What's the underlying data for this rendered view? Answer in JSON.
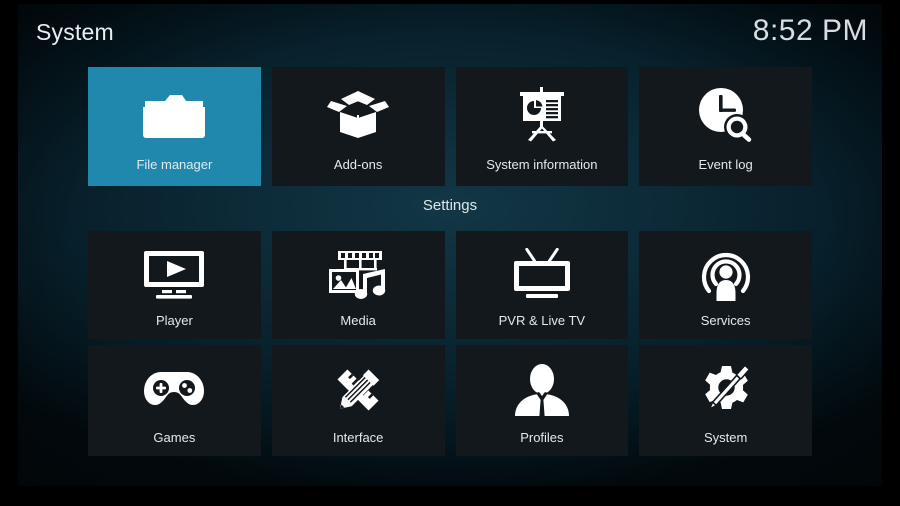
{
  "header": {
    "title": "System",
    "clock": "8:52 PM"
  },
  "settings_section": {
    "label": "Settings"
  },
  "colors": {
    "selected_tile": "#2188ad",
    "tile_background": "#13181d",
    "text": "#e3e9ec",
    "background_teal": "#0c2936"
  },
  "rows": {
    "top": [
      {
        "label": "File manager",
        "icon": "folder-open-icon",
        "selected": true
      },
      {
        "label": "Add-ons",
        "icon": "open-box-icon",
        "selected": false
      },
      {
        "label": "System information",
        "icon": "presentation-board-icon",
        "selected": false
      },
      {
        "label": "Event log",
        "icon": "clock-search-icon",
        "selected": false
      }
    ],
    "middle": [
      {
        "label": "Player",
        "icon": "monitor-play-icon",
        "selected": false
      },
      {
        "label": "Media",
        "icon": "film-photo-music-icon",
        "selected": false
      },
      {
        "label": "PVR & Live TV",
        "icon": "tv-antenna-icon",
        "selected": false
      },
      {
        "label": "Services",
        "icon": "broadcast-person-icon",
        "selected": false
      }
    ],
    "bottom": [
      {
        "label": "Games",
        "icon": "gamepad-icon",
        "selected": false
      },
      {
        "label": "Interface",
        "icon": "pencil-ruler-icon",
        "selected": false
      },
      {
        "label": "Profiles",
        "icon": "person-bust-icon",
        "selected": false
      },
      {
        "label": "System",
        "icon": "gear-screwdriver-icon",
        "selected": false
      }
    ]
  }
}
